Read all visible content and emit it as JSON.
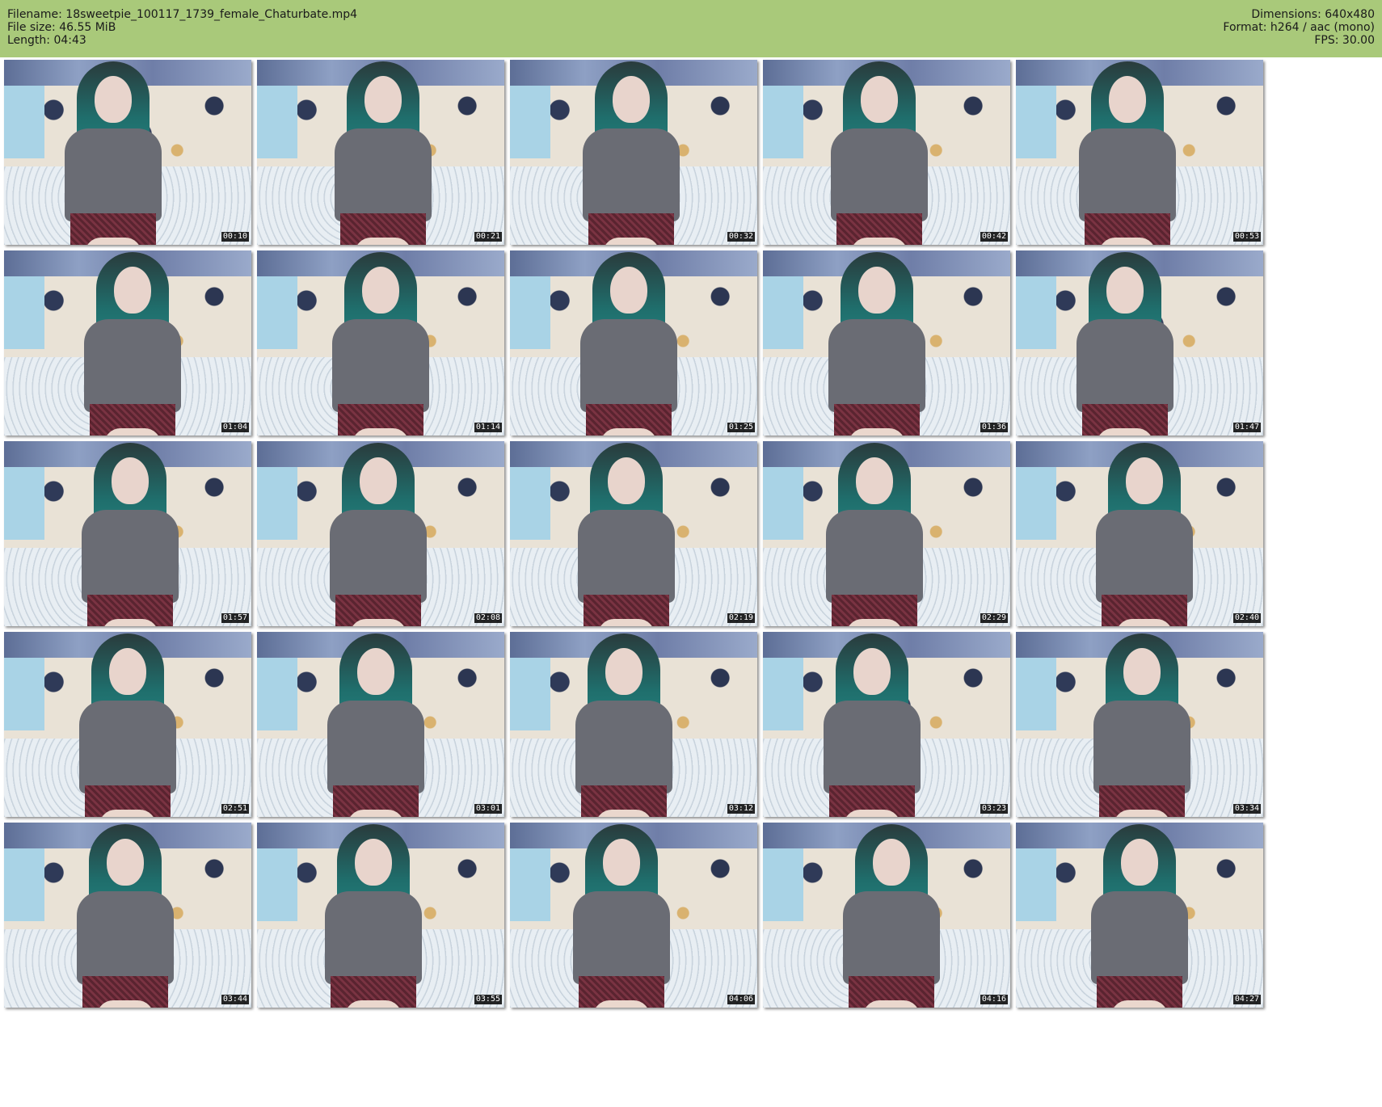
{
  "header": {
    "filename_label": "Filename: 18sweetpie_100117_1739_female_Chaturbate.mp4",
    "filesize_label": "File size: 46.55 MiB",
    "length_label": "Length: 04:43",
    "dimensions_label": "Dimensions: 640x480",
    "format_label": "Format: h264 / aac (mono)",
    "fps_label": "FPS: 30.00"
  },
  "colors": {
    "header_bg": "#a9c97a",
    "timestamp_bg": "#000000",
    "timestamp_text": "#ffffff"
  },
  "thumbnails": [
    {
      "timestamp": "00:10"
    },
    {
      "timestamp": "00:21"
    },
    {
      "timestamp": "00:32"
    },
    {
      "timestamp": "00:42"
    },
    {
      "timestamp": "00:53"
    },
    {
      "timestamp": "01:04"
    },
    {
      "timestamp": "01:14"
    },
    {
      "timestamp": "01:25"
    },
    {
      "timestamp": "01:36"
    },
    {
      "timestamp": "01:47"
    },
    {
      "timestamp": "01:57"
    },
    {
      "timestamp": "02:08"
    },
    {
      "timestamp": "02:19"
    },
    {
      "timestamp": "02:29"
    },
    {
      "timestamp": "02:40"
    },
    {
      "timestamp": "02:51"
    },
    {
      "timestamp": "03:01"
    },
    {
      "timestamp": "03:12"
    },
    {
      "timestamp": "03:23"
    },
    {
      "timestamp": "03:34"
    },
    {
      "timestamp": "03:44"
    },
    {
      "timestamp": "03:55"
    },
    {
      "timestamp": "04:06"
    },
    {
      "timestamp": "04:16"
    },
    {
      "timestamp": "04:27"
    }
  ]
}
